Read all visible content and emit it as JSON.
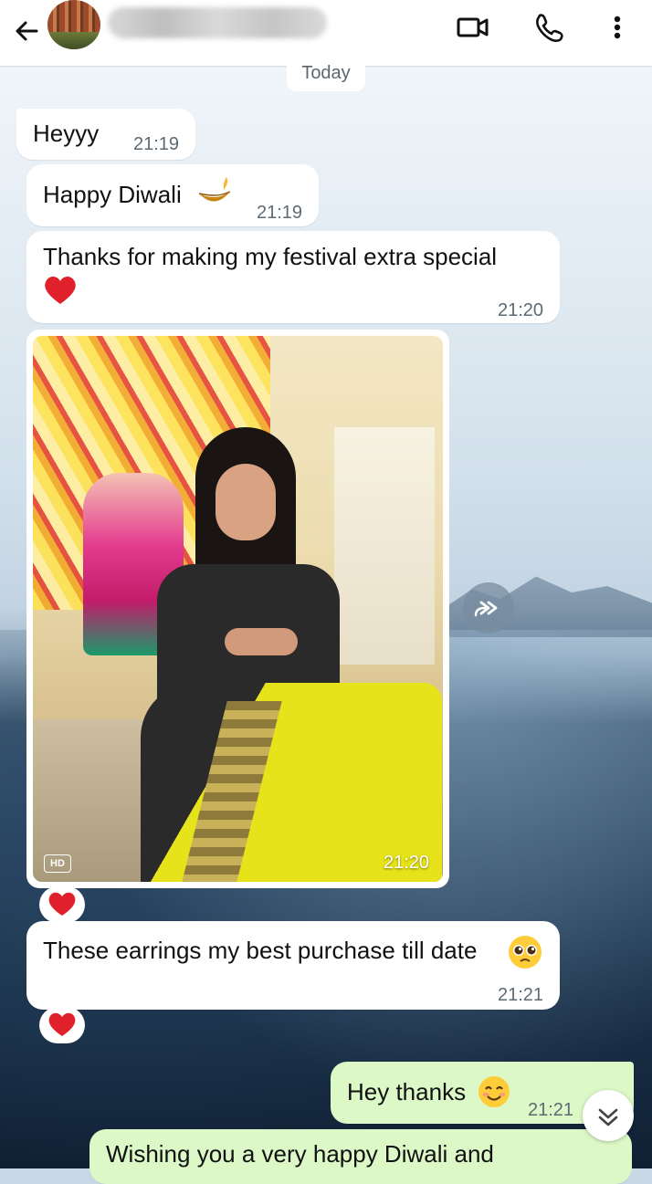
{
  "header": {
    "contact_name": "",
    "icons": [
      "back-arrow-icon",
      "video-call-icon",
      "voice-call-icon",
      "more-options-icon"
    ]
  },
  "date_divider": "Today",
  "messages": [
    {
      "text": "Heyyy",
      "time": "21:19",
      "direction": "incoming"
    },
    {
      "text": "Happy Diwali",
      "emoji": "diya-lamp",
      "time": "21:19",
      "direction": "incoming"
    },
    {
      "text": "Thanks for making my festival extra special",
      "emoji": "red-heart",
      "time": "21:20",
      "direction": "incoming"
    },
    {
      "type": "image",
      "badge": "HD",
      "time": "21:20",
      "direction": "incoming",
      "reaction": "red-heart"
    },
    {
      "text": "These earrings my best purchase till date",
      "emoji": "pleading-face",
      "time": "21:21",
      "direction": "incoming",
      "reaction": "red-heart"
    },
    {
      "text": "Hey thanks",
      "emoji": "smiling-face",
      "time": "21:21",
      "direction": "outgoing"
    },
    {
      "text": "Wishing you a very happy Diwali and",
      "direction": "outgoing"
    }
  ],
  "colors": {
    "incoming_bubble": "#ffffff",
    "outgoing_bubble": "#dcf8c6",
    "heart": "#e0202a"
  }
}
